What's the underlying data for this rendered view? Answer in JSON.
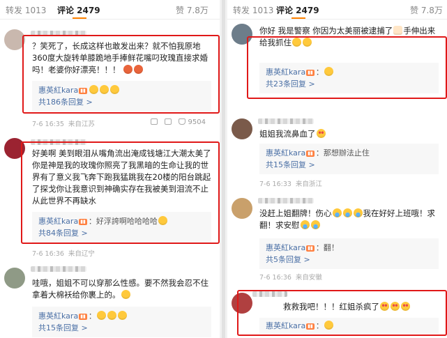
{
  "left": {
    "tabs": {
      "repost": "转发 1013",
      "comments": "评论 2479",
      "likes": "赞 7.8万"
    },
    "comments": [
      {
        "text": "？笑死了，长成这样也敢发出来？就不怕我原地360度大旋转单膝跪地手捧鲜花嘴叼玫瑰直接求婚吗！老婆你好漂亮！！！",
        "reply_name": "惠英紅kara",
        "reply_text": "",
        "reply_count": "共186条回复 >",
        "time": "7-6 16:35",
        "location": "来自江苏",
        "likes": "9504"
      },
      {
        "text": "好美啊 美到眼泪从嘴角流出淹成钱塘江大潮太美了你是神是我的玫瑰你照亮了我黑暗的生命让我的世界有了意义我飞奔下跑我猛跳我在20楼的阳台跳起了探戈你让我意识到神确实存在我被美到泪流不止从此世界不再缺水",
        "reply_name": "惠英紅kara",
        "reply_text": "：好浮誇啊哈哈哈哈",
        "reply_count": "共84条回复 >",
        "time": "7-6 16:36",
        "location": "来自辽宁"
      },
      {
        "text": "哇哦，姐姐不可以穿那么性感。要不然我会忍不住拿着大棉袄给你裹上的。",
        "reply_name": "惠英紅kara",
        "reply_text": "：",
        "reply_count": "共15条回复 >"
      }
    ]
  },
  "right": {
    "tabs": {
      "repost": "转发 1013",
      "comments": "评论 2479",
      "likes": "赞 7.8万"
    },
    "comments": [
      {
        "text": "你好 我是警察 你因为太美丽被逮捕了",
        "text2": "手伸出来给我抓住",
        "reply_name": "惠英紅kara",
        "reply_text": "：",
        "reply_count": "共23条回复 >"
      },
      {
        "text": "姐姐我流鼻血了",
        "reply_name": "惠英紅kara",
        "reply_text": "：那想辦法止住",
        "reply_count": "共15条回复 >",
        "time": "7-6 16:33",
        "location": "来自浙江"
      },
      {
        "text": "没赶上姐翻牌！伤心",
        "text2": "我在好好上班哦！求翻！求安慰",
        "reply_name": "惠英紅kara",
        "reply_text": "：翻！",
        "reply_count": "共5条回复 >",
        "time": "7-6 16:36",
        "location": "来自安徽"
      },
      {
        "text": "救救我吧！！！红姐杀疯了",
        "reply_name": "惠英紅kara",
        "reply_text": "：",
        "badge": "VIP"
      }
    ]
  },
  "colors": {
    "highlight": "#e01818",
    "link": "#4a6fa5",
    "tab_indicator": "#ff8200"
  }
}
